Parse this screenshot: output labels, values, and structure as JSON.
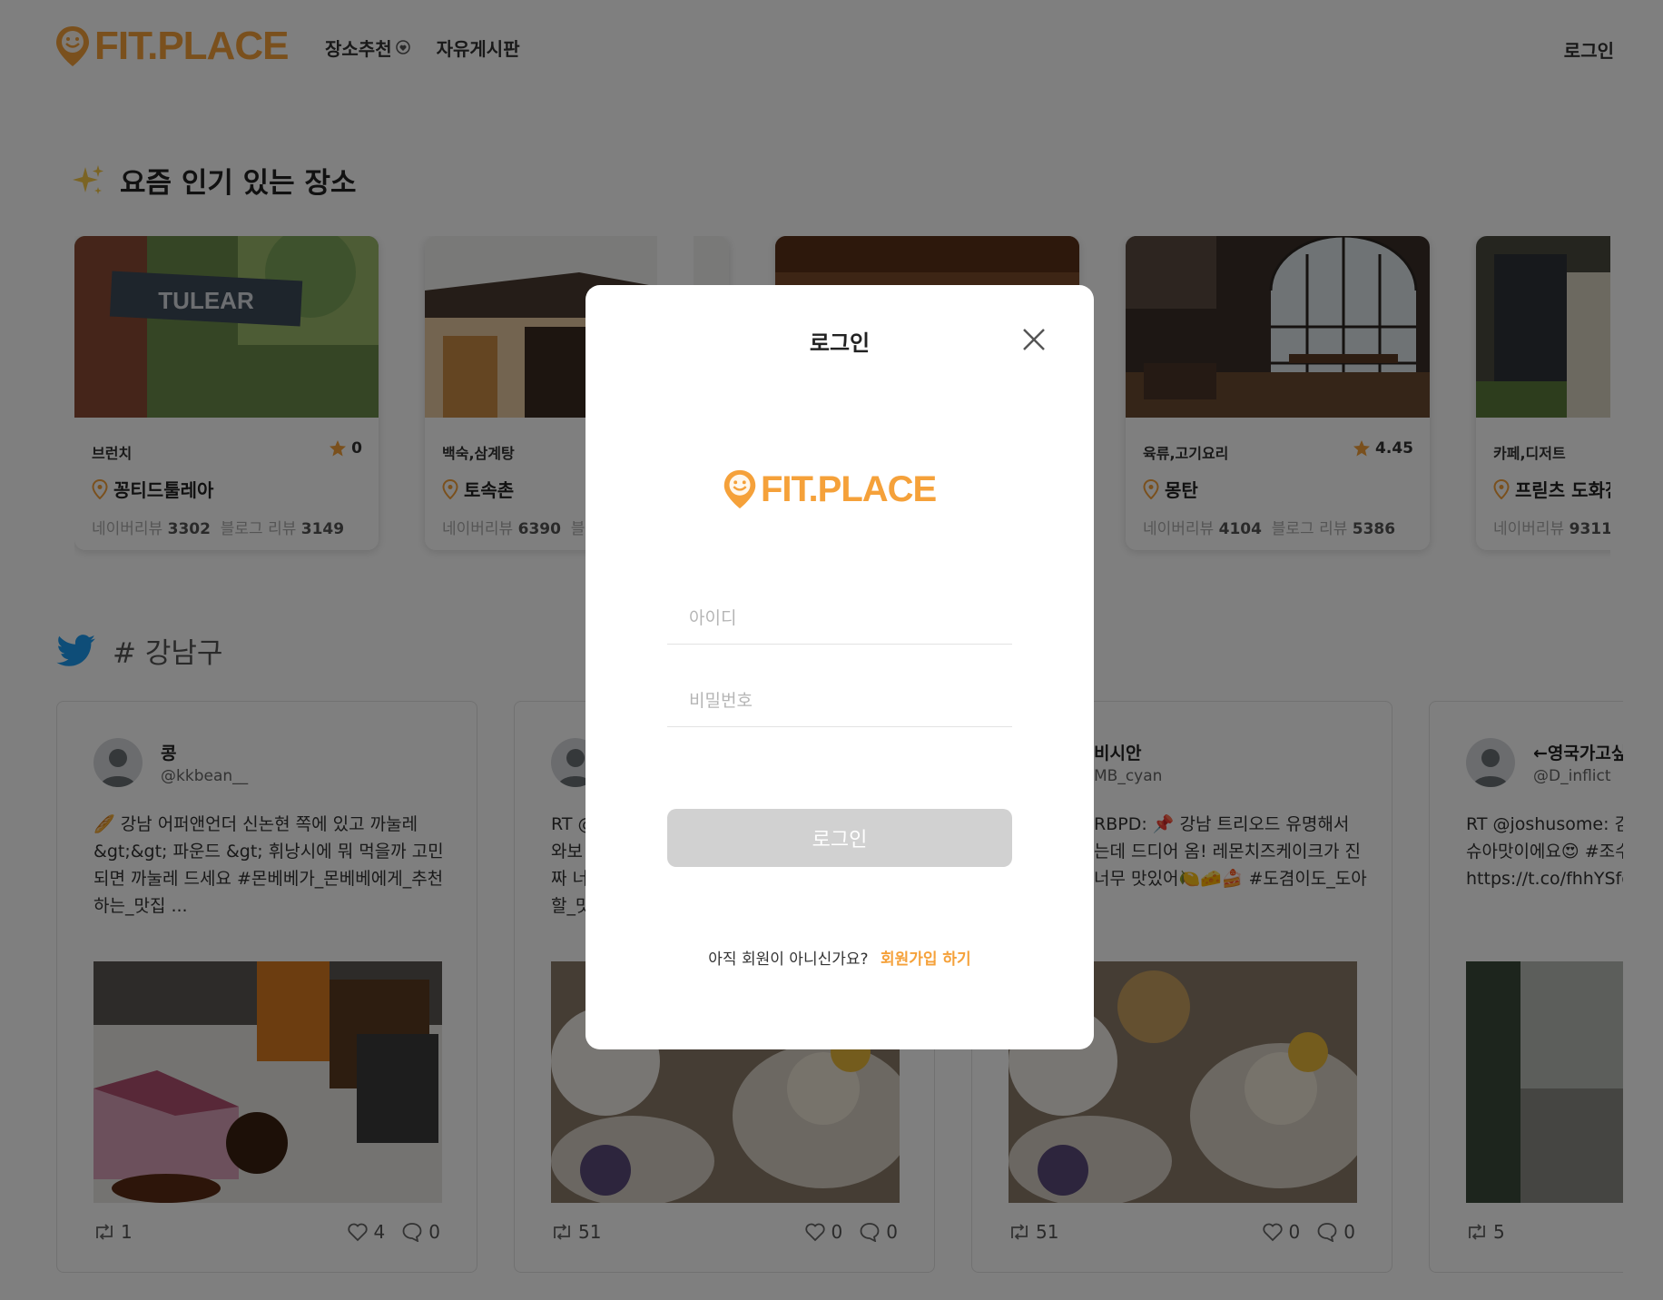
{
  "header": {
    "logo_text": "FIT.PLACE",
    "nav": [
      {
        "label": "장소추천"
      },
      {
        "label": "자유게시판"
      }
    ],
    "login_label": "로그인"
  },
  "popular": {
    "icon": "sparkles-icon",
    "title": "요즘 인기 있는 장소",
    "review_label_naver": "네이버리뷰",
    "review_label_blog": "블로그 리뷰",
    "places": [
      {
        "category": "브런치",
        "rating": "0",
        "name": "꽁티드툴레아",
        "naver": "3302",
        "blog": "3149",
        "sign": "TULEAR"
      },
      {
        "category": "백숙,삼계탕",
        "rating": "",
        "name": "토속촌",
        "naver": "6390",
        "blog": ""
      },
      {
        "category": "",
        "rating": "",
        "name": "",
        "naver": "",
        "blog": ""
      },
      {
        "category": "육류,고기요리",
        "rating": "4.45",
        "name": "몽탄",
        "naver": "4104",
        "blog": "5386"
      },
      {
        "category": "카페,디저트",
        "rating": "",
        "name": "프릳츠 도화점",
        "naver": "9311",
        "blog": ""
      }
    ]
  },
  "twitter": {
    "icon": "twitter-bird-icon",
    "hashtag": "# 강남구",
    "tweets": [
      {
        "name": "콩",
        "handle": "@kkbean__",
        "text": "🥖 강남 어퍼앤언더 신논현 쪽에 있고 까눌레\n&gt;&gt; 파운드 &gt; 휘낭시에 뭐 먹을까 고민\n되면 까눌레 드세요 #몬베베가_몬베베에게_추천\n하는_맛집 ...",
        "retweets": "1",
        "likes": "4",
        "replies": "0"
      },
      {
        "name": "",
        "handle": "",
        "text": "RT @\n와보\n짜 너\n할_맛",
        "retweets": "51",
        "likes": "0",
        "replies": "0"
      },
      {
        "name": "비시안",
        "handle": "MB_cyan",
        "text": "RBPD: 📌 강남 트리오드 유명해서\n는데 드디어 옴! 레몬치즈케이크가 진\n너무 맛있어🍋🧀🍰 #도겸이도_도아",
        "retweets": "51",
        "likes": "0",
        "replies": "0"
      },
      {
        "name": "←영국가고싶",
        "handle": "@D_inflict",
        "text": "RT @joshusome: 김\n슈아맛이에요😍 #조수\nhttps://t.co/fhhYSfc",
        "retweets": "5",
        "likes": "",
        "replies": ""
      }
    ]
  },
  "modal": {
    "title": "로그인",
    "logo_text": "FIT.PLACE",
    "id_placeholder": "아이디",
    "pw_placeholder": "비밀번호",
    "submit_label": "로그인",
    "signup_prompt": "아직 회원이 아니신가요?",
    "signup_link": "회원가입 하기"
  },
  "colors": {
    "brand": "#f5a13a",
    "overlay": "rgba(0,0,0,0.5)",
    "button_disabled": "#d1d1d1",
    "twitter": "#1d9bf0"
  }
}
